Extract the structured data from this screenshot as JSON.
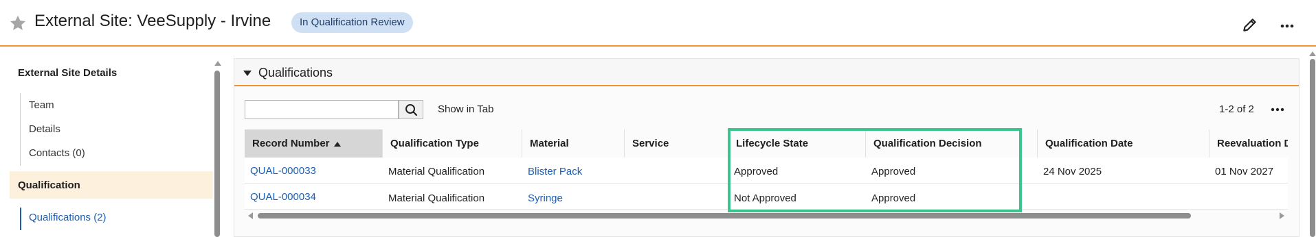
{
  "header": {
    "title": "External Site: VeeSupply - Irvine",
    "status_badge": "In Qualification Review",
    "icons": [
      "star-icon",
      "pencil-icon",
      "more-icon"
    ]
  },
  "sidebar": {
    "section_title": "External Site Details",
    "items": [
      {
        "label": "Team"
      },
      {
        "label": "Details"
      },
      {
        "label": "Contacts (0)"
      }
    ],
    "qualification_title": "Qualification",
    "qualification_items": [
      {
        "label": "Qualifications (2)",
        "active": true
      }
    ]
  },
  "panel": {
    "title": "Qualifications",
    "search": {
      "value": "",
      "placeholder": ""
    },
    "show_in_tab_label": "Show in Tab",
    "count_label": "1-2 of 2"
  },
  "table": {
    "columns": [
      "Record Number",
      "Qualification Type",
      "Material",
      "Service",
      "Lifecycle State",
      "Qualification Decision",
      "Qualification Date",
      "Reevaluation Date"
    ],
    "sorted_column": "Record Number",
    "sort_direction": "ascending",
    "rows": [
      {
        "record_number": "QUAL-000033",
        "qualification_type": "Material Qualification",
        "material": "Blister Pack",
        "service": "",
        "lifecycle_state": "Approved",
        "qualification_decision": "Approved",
        "qualification_date": "24 Nov 2025",
        "reevaluation_date": "01 Nov 2027"
      },
      {
        "record_number": "QUAL-000034",
        "qualification_type": "Material Qualification",
        "material": "Syringe",
        "service": "",
        "lifecycle_state": "Not Approved",
        "qualification_decision": "Approved",
        "qualification_date": "",
        "reevaluation_date": ""
      }
    ]
  },
  "colors": {
    "accent_orange": "#f0922e",
    "link_blue": "#1a5fb4",
    "badge_bg": "#cfe0f5",
    "highlight_green": "#3cc48f",
    "sidebar_active_bg": "#fdf0dc"
  }
}
